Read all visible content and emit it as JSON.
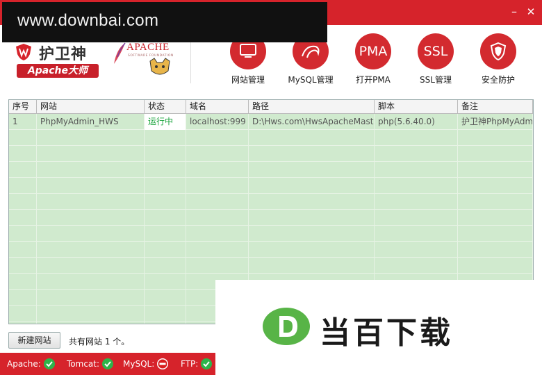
{
  "window": {
    "minimize_glyph": "–",
    "close_glyph": "✕"
  },
  "watermark_top": "www.downbai.com",
  "logo": {
    "name": "护卫神",
    "badge": "Apache大师",
    "apache_text": "APACHE",
    "apache_sub": "SOFTWARE FOUNDATION"
  },
  "toolbar": {
    "items": [
      {
        "label": "网站管理",
        "icon": "monitor-icon",
        "glyph": ""
      },
      {
        "label": "MySQL管理",
        "icon": "dolphin-icon",
        "glyph": ""
      },
      {
        "label": "打开PMA",
        "icon": "pma-icon",
        "glyph": "PMA"
      },
      {
        "label": "SSL管理",
        "icon": "ssl-icon",
        "glyph": "SSL"
      },
      {
        "label": "安全防护",
        "icon": "shield-icon",
        "glyph": ""
      }
    ]
  },
  "table": {
    "columns": [
      "序号",
      "网站",
      "状态",
      "域名",
      "路径",
      "脚本",
      "备注"
    ],
    "rows": [
      [
        "1",
        "PhpMyAdmin_HWS",
        "运行中",
        "localhost:999",
        "D:\\Hws.com\\HwsApacheMaste",
        "php(5.6.40.0)",
        "护卫神PhpMyAdm"
      ]
    ]
  },
  "footer": {
    "new_site": "新建网站",
    "site_count": "共有网站 1 个。"
  },
  "statusbar": {
    "items": [
      {
        "label": "Apache:",
        "status": "ok"
      },
      {
        "label": "Tomcat:",
        "status": "ok"
      },
      {
        "label": "MySQL:",
        "status": "stopped"
      },
      {
        "label": "FTP:",
        "status": "ok"
      }
    ]
  },
  "watermark_bottom": "当百下载",
  "colors": {
    "brand_red": "#d6232b",
    "grid_green": "#d0eace",
    "running_green": "#19a33b"
  }
}
